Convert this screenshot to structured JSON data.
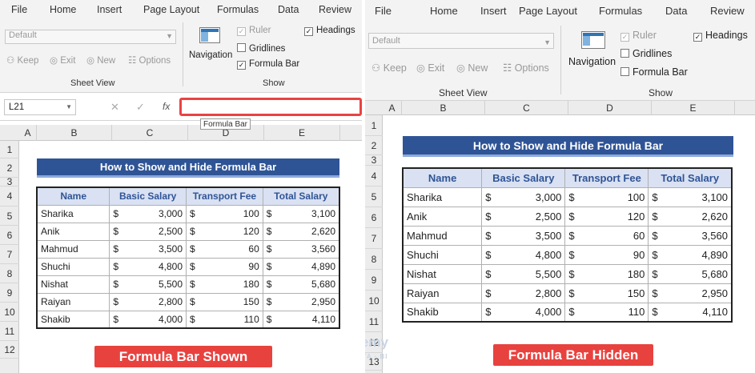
{
  "left": {
    "menu": [
      "File",
      "Home",
      "Insert",
      "Page Layout",
      "Formulas",
      "Data",
      "Review"
    ],
    "view_dropdown": "Default",
    "sheet_view_buttons": [
      "Keep",
      "Exit",
      "New",
      "Options"
    ],
    "sheet_view_group": "Sheet View",
    "navigation_label": "Navigation",
    "show_checks": {
      "ruler": "Ruler",
      "gridlines": "Gridlines",
      "formula_bar": "Formula Bar",
      "headings": "Headings"
    },
    "show_group": "Show",
    "name_box": "L21",
    "fx": "fx",
    "tooltip": "Formula Bar",
    "columns": [
      "A",
      "B",
      "C",
      "D",
      "E"
    ],
    "rows": [
      "1",
      "2",
      "3",
      "4",
      "5",
      "6",
      "7",
      "8",
      "9",
      "10",
      "11",
      "12"
    ],
    "banner": "Formula Bar Shown"
  },
  "right": {
    "menu": [
      "File",
      "Home",
      "Insert",
      "Page Layout",
      "Formulas",
      "Data",
      "Review"
    ],
    "view_dropdown": "Default",
    "sheet_view_buttons": [
      "Keep",
      "Exit",
      "New",
      "Options"
    ],
    "sheet_view_group": "Sheet View",
    "navigation_label": "Navigation",
    "show_checks": {
      "ruler": "Ruler",
      "gridlines": "Gridlines",
      "formula_bar": "Formula Bar",
      "headings": "Headings"
    },
    "show_group": "Show",
    "columns": [
      "A",
      "B",
      "C",
      "D",
      "E"
    ],
    "rows": [
      "1",
      "2",
      "3",
      "4",
      "5",
      "6",
      "7",
      "8",
      "9",
      "10",
      "11",
      "12",
      "13"
    ],
    "banner": "Formula Bar Hidden"
  },
  "sheet": {
    "title": "How to Show and Hide Formula Bar",
    "headers": [
      "Name",
      "Basic Salary",
      "Transport Fee",
      "Total Salary"
    ],
    "currency": "$",
    "rows": [
      [
        "Sharika",
        "3,000",
        "100",
        "3,100"
      ],
      [
        "Anik",
        "2,500",
        "120",
        "2,620"
      ],
      [
        "Mahmud",
        "3,500",
        "60",
        "3,560"
      ],
      [
        "Shuchi",
        "4,800",
        "90",
        "4,890"
      ],
      [
        "Nishat",
        "5,500",
        "180",
        "5,680"
      ],
      [
        "Raiyan",
        "2,800",
        "150",
        "2,950"
      ],
      [
        "Shakib",
        "4,000",
        "110",
        "4,110"
      ]
    ]
  },
  "watermark": {
    "name": "exceldemy",
    "tagline": "EXCEL · DATA · BI"
  },
  "colors": {
    "title_bg": "#2f5496",
    "banner": "#e8423f",
    "highlight": "#e84343"
  }
}
